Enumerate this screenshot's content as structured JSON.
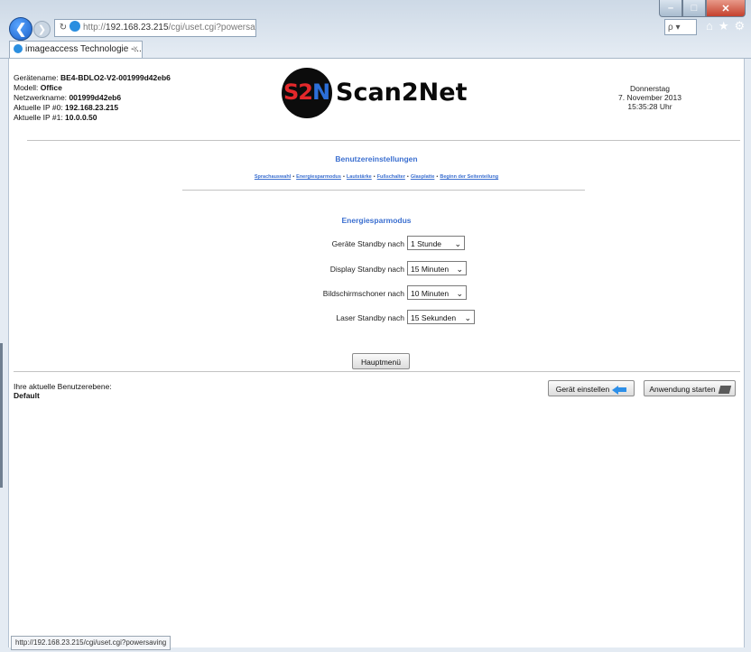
{
  "browser": {
    "address_url_prefix": "http://",
    "address_host": "192.168.23.215",
    "address_path": "/cgi/uset.cgi?powersaving",
    "search_placeholder": "ρ ▾",
    "tab_title": "imageaccess Technologie -...",
    "tab_close": "×",
    "status_url": "http://192.168.23.215/cgi/uset.cgi?powersaving"
  },
  "device": {
    "name_label": "Gerätename:",
    "name_value": "BE4-BDLO2-V2-001999d42eb6",
    "model_label": "Modell:",
    "model_value": "Office",
    "netname_label": "Netzwerkname:",
    "netname_value": "001999d42eb6",
    "ip0_label": "Aktuelle IP #0:",
    "ip0_value": "192.168.23.215",
    "ip1_label": "Aktuelle IP #1:",
    "ip1_value": "10.0.0.50"
  },
  "logo": {
    "mark_s": "S",
    "mark_2": "2",
    "mark_n": "N",
    "text": "Scan2Net"
  },
  "datetime": {
    "weekday": "Donnerstag",
    "date": "7. November 2013",
    "time": "15:35:28 Uhr"
  },
  "page": {
    "heading": "Benutzereinstellungen",
    "nav_links": [
      "Sprachauswahl",
      "Energiesparmodus",
      "Lautstärke",
      "Fußschalter",
      "Glasplatte",
      "Beginn der Seitenteilung"
    ],
    "nav_separator": "•",
    "section_title": "Energiesparmodus",
    "settings": [
      {
        "label": "Geräte Standby nach",
        "value": "1 Stunde"
      },
      {
        "label": "Display Standby nach",
        "value": "15 Minuten"
      },
      {
        "label": "Bildschirmschoner nach",
        "value": "10 Minuten"
      },
      {
        "label": "Laser Standby nach",
        "value": "15 Sekunden"
      }
    ],
    "main_menu_button": "Hauptmenü",
    "user_level_label": "Ihre aktuelle Benutzerebene:",
    "user_level_value": "Default",
    "device_settings_button": "Gerät einstellen",
    "start_app_button": "Anwendung starten"
  },
  "icons": {
    "back": "back-arrow-icon",
    "forward": "forward-arrow-icon",
    "refresh": "refresh-icon",
    "home": "home-icon",
    "favorites": "star-icon",
    "tools": "gear-icon"
  },
  "colors": {
    "link_blue": "#3b6fd0",
    "logo_red": "#e3282b",
    "logo_blue": "#2c6fd9"
  }
}
